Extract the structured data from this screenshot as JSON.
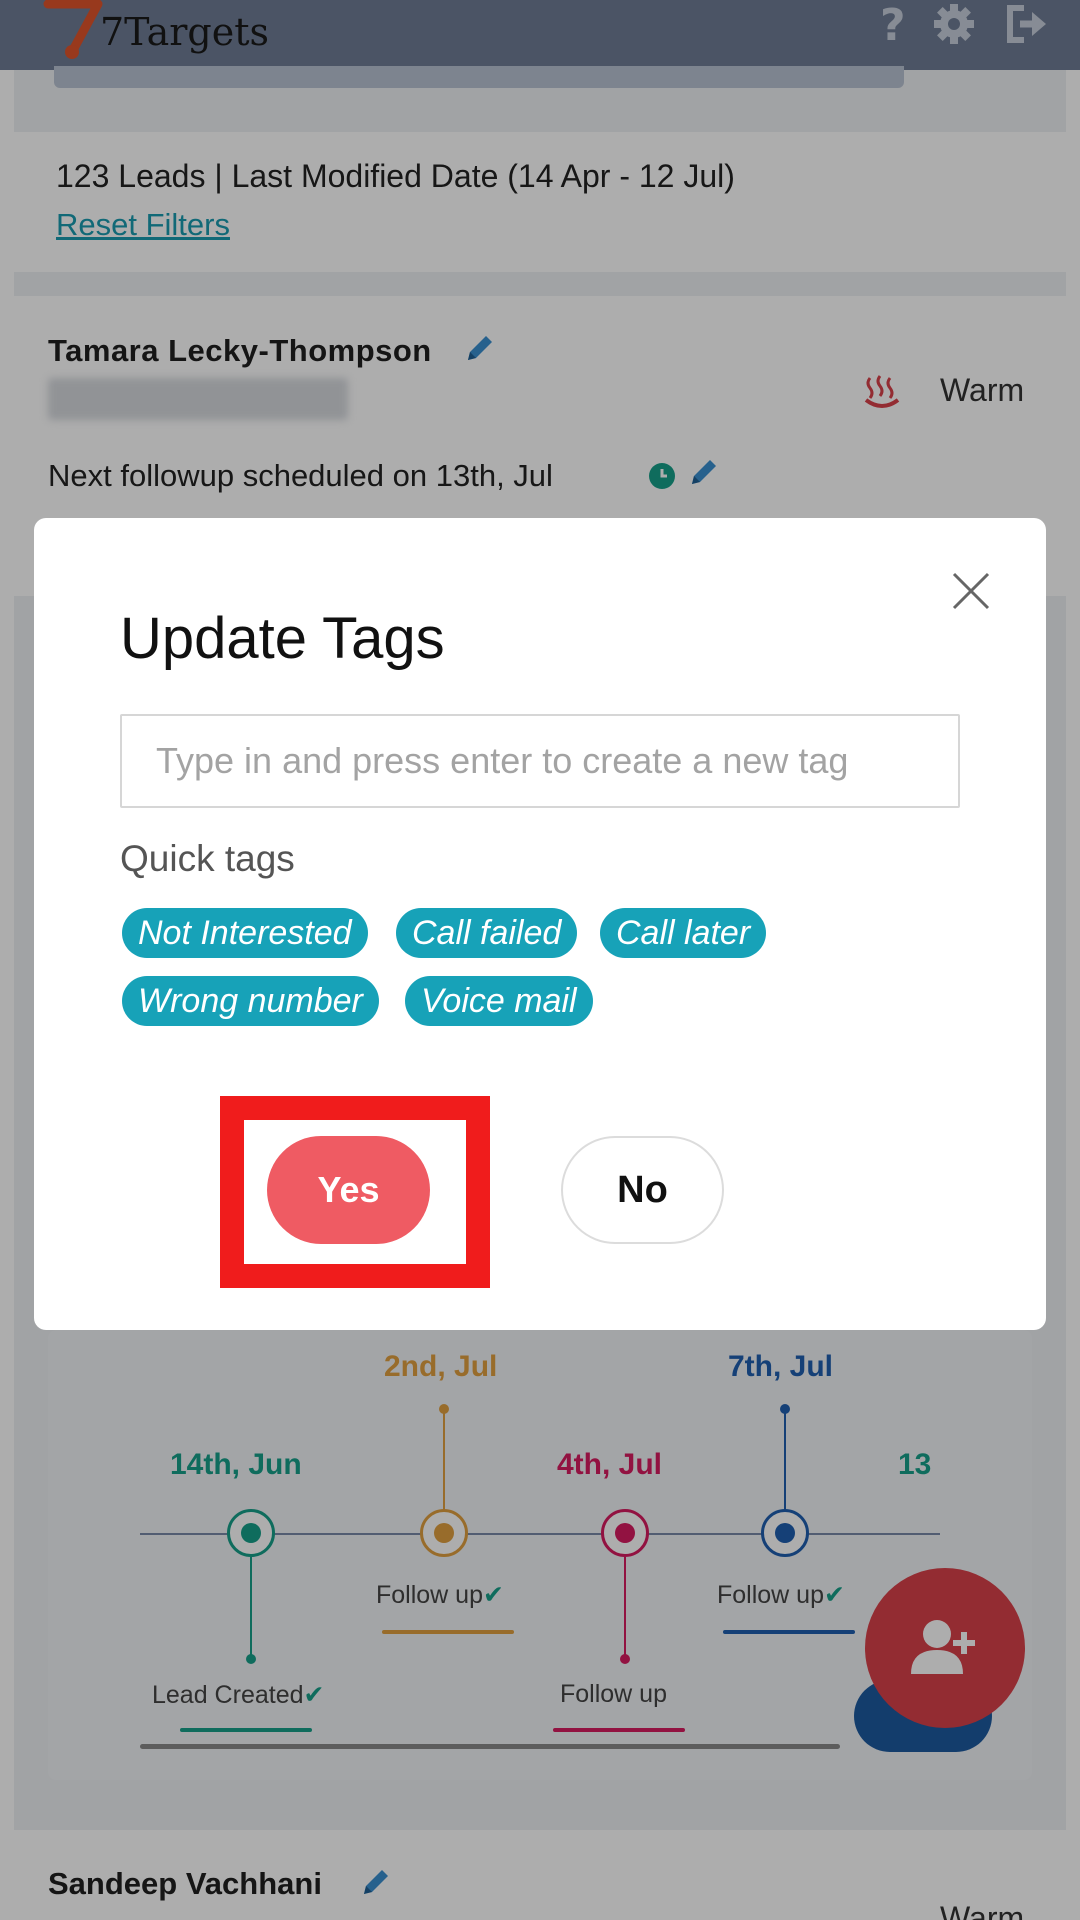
{
  "app": {
    "name": "7Targets",
    "header_icons": [
      "help-icon",
      "settings-gear-icon",
      "logout-icon"
    ]
  },
  "summary": {
    "text": "123 Leads | Last Modified Date (14 Apr - 12 Jul)",
    "reset_label": "Reset Filters"
  },
  "lead": {
    "name": "Tamara Lecky-Thompson",
    "status": "Warm",
    "followup": "Next followup scheduled on 13th, Jul"
  },
  "timeline": {
    "events": [
      {
        "date": "14th, Jun",
        "label": "Lead Created",
        "color": "#17a08a"
      },
      {
        "date": "2nd, Jul",
        "label": "Follow up",
        "color": "#e0a040"
      },
      {
        "date": "4th, Jul",
        "label": "Follow up",
        "color": "#d81b60"
      },
      {
        "date": "7th, Jul",
        "label": "Follow up",
        "color": "#1f5fb0"
      },
      {
        "date": "13",
        "label": "",
        "color": "#17a08a"
      }
    ]
  },
  "next_lead": {
    "name": "Sandeep Vachhani",
    "status": "Warm"
  },
  "modal": {
    "title": "Update Tags",
    "input_placeholder": "Type in and press enter to create a new tag",
    "quick_tags_label": "Quick tags",
    "quick_tags": [
      "Not Interested",
      "Call failed",
      "Call later",
      "Wrong number",
      "Voice mail"
    ],
    "yes_label": "Yes",
    "no_label": "No"
  },
  "colors": {
    "header": "#6f7d95",
    "accent_teal": "#17a2b8",
    "yes_button": "#ef5b63",
    "highlight": "#f01c1c",
    "fab": "#d9414a"
  }
}
